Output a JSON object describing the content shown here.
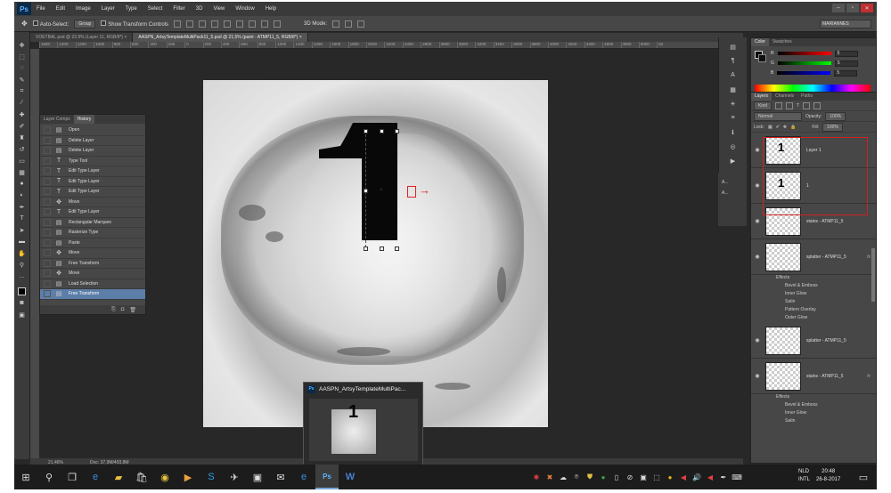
{
  "app": {
    "logo": "Ps",
    "menu": [
      "File",
      "Edit",
      "Image",
      "Layer",
      "Type",
      "Select",
      "Filter",
      "3D",
      "View",
      "Window",
      "Help"
    ],
    "window_controls": [
      "–",
      "▫",
      "✕"
    ]
  },
  "options_bar": {
    "auto_select_label": "Auto-Select:",
    "auto_select_value": "Group",
    "show_transform_label": "Show Transform Controls",
    "mode_3d_label": "3D Mode:",
    "workspace": "MARIANNES"
  },
  "tabs": [
    {
      "label": "VOETBAL.psd @ 22,9% (Layer 11, RGB/8*)",
      "close": "×"
    },
    {
      "label": "AASPN_ArtsyTemplateMultiPack11_5.psd @ 21,5% (paint - ATMP11_5, RGB/8*)",
      "close": "×"
    }
  ],
  "ruler_ticks": [
    "1600",
    "1400",
    "1200",
    "1000",
    "800",
    "600",
    "400",
    "200",
    "0",
    "200",
    "400",
    "600",
    "800",
    "1000",
    "1200",
    "1400",
    "1600",
    "1800",
    "2000",
    "2200",
    "2400",
    "2600",
    "2800",
    "3000",
    "3200",
    "3400",
    "3600",
    "3800",
    "4000",
    "4200",
    "4400",
    "4600",
    "4800",
    "5000",
    "52"
  ],
  "canvas": {
    "numeral": "1"
  },
  "history_panel": {
    "tabs": [
      "Layer Comps",
      "History"
    ],
    "active_tab": "History",
    "items": [
      {
        "label": "Open",
        "icon": "doc-icon"
      },
      {
        "label": "Delete Layer",
        "icon": "doc-icon"
      },
      {
        "label": "Delete Layer",
        "icon": "doc-icon"
      },
      {
        "label": "Type Tool",
        "icon": "type-icon"
      },
      {
        "label": "Edit Type Layer",
        "icon": "type-icon"
      },
      {
        "label": "Edit Type Layer",
        "icon": "type-icon"
      },
      {
        "label": "Edit Type Layer",
        "icon": "type-icon"
      },
      {
        "label": "Move",
        "icon": "move-icon"
      },
      {
        "label": "Edit Type Layer",
        "icon": "type-icon"
      },
      {
        "label": "Rectangular Marquee",
        "icon": "doc-icon"
      },
      {
        "label": "Rasterize Type",
        "icon": "doc-icon"
      },
      {
        "label": "Paste",
        "icon": "doc-icon"
      },
      {
        "label": "Move",
        "icon": "move-icon"
      },
      {
        "label": "Free Transform",
        "icon": "doc-icon"
      },
      {
        "label": "Move",
        "icon": "move-icon"
      },
      {
        "label": "Load Selection",
        "icon": "doc-icon"
      },
      {
        "label": "Free Transform",
        "icon": "doc-icon"
      }
    ],
    "selected_index": 16
  },
  "status_bar": {
    "zoom": "21,46%",
    "doc": "Doc: 37,9M/493,8M"
  },
  "thumbnail": {
    "title": "AASPN_ArtsyTemplateMultiPac...",
    "numeral": "1"
  },
  "color_panel": {
    "tabs": [
      "Color",
      "Swatches"
    ],
    "channels": [
      {
        "label": "R",
        "value": "5",
        "gradient": "linear-gradient(to right,#000,#f00)"
      },
      {
        "label": "G",
        "value": "5",
        "gradient": "linear-gradient(to right,#000,#0f0)"
      },
      {
        "label": "B",
        "value": "5",
        "gradient": "linear-gradient(to right,#000,#00f)"
      }
    ]
  },
  "strip2": [
    "A...",
    "A..."
  ],
  "layers_panel": {
    "tabs": [
      "Layers",
      "Channels",
      "Paths"
    ],
    "filter_label": "Kind",
    "blend_mode": "Normal",
    "opacity_label": "Opacity:",
    "opacity": "100%",
    "lock_label": "Lock:",
    "fill_label": "Fill:",
    "fill": "100%",
    "layers": [
      {
        "name": "Layer 1",
        "numeral": "1",
        "fx": "",
        "effects": []
      },
      {
        "name": "1",
        "numeral": "1",
        "fx": "",
        "effects": []
      },
      {
        "name": "stains - ATMP11_5",
        "numeral": "",
        "fx": "",
        "effects": []
      },
      {
        "name": "splatter - ATMP11_5",
        "numeral": "",
        "fx": "fx",
        "effects_head": "Effects",
        "effects": [
          "Bevel & Emboss",
          "Inner Glow",
          "Satin",
          "Pattern Overlay",
          "Outer Glow"
        ]
      },
      {
        "name": "splatter - ATMP11_5",
        "numeral": "",
        "fx": "",
        "effects": []
      },
      {
        "name": "stains - ATMP11_5",
        "numeral": "",
        "fx": "fx",
        "effects_head": "Effects",
        "effects": [
          "Bevel & Emboss",
          "Inner Glow",
          "Satin"
        ]
      }
    ]
  },
  "taskbar": {
    "lang": [
      "NLD",
      "INTL"
    ],
    "time": "20:48",
    "date": "26-8-2017"
  },
  "colors": {
    "selection_blue": "#5c7ea8",
    "annotation_red": "#e02020"
  }
}
